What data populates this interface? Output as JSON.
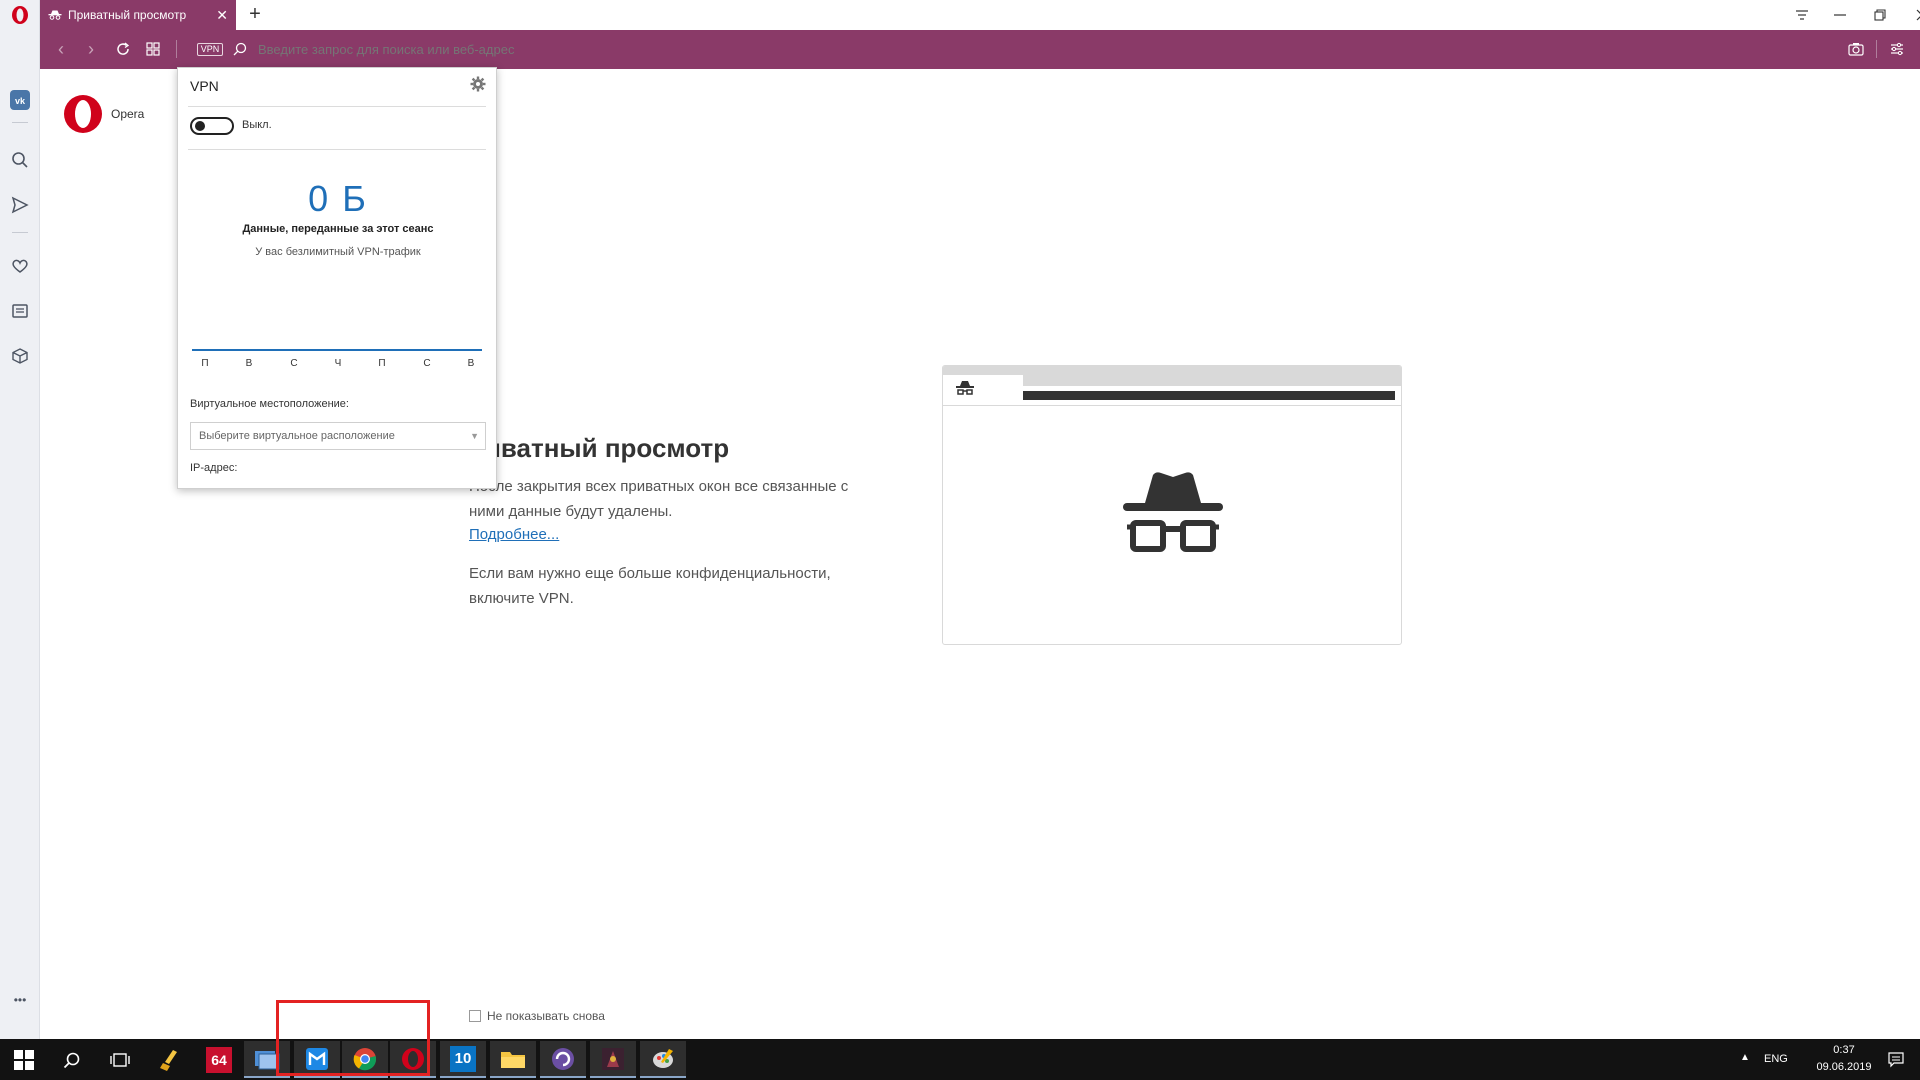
{
  "browser": {
    "tab_title": "Приватный просмотр",
    "address_placeholder": "Введите запрос для поиска или веб-адрес",
    "vpn_badge": "VPN"
  },
  "sidebar": {
    "items": [
      "vk-icon",
      "search-icon",
      "send-icon",
      "heart-icon",
      "news-icon",
      "box-icon"
    ],
    "more_label": "•••"
  },
  "speed_dial": {
    "logo_text": "Opera"
  },
  "private_page": {
    "title": "риватный просмотр",
    "text1": "После закрытия всех приватных окон все связанные с ними данные будут удалены.",
    "link": "Подробнее...",
    "text2": "Если вам нужно еще больше конфиденциальности, включите VPN.",
    "dont_show": "Не показывать снова"
  },
  "vpn_popup": {
    "title": "VPN",
    "toggle_label": "Выкл.",
    "data_amount": "0 Б",
    "data_caption": "Данные, переданные за этот сеанс",
    "unlimited": "У вас безлимитный VPN-трафик",
    "days": [
      "П",
      "В",
      "С",
      "Ч",
      "П",
      "С",
      "В"
    ],
    "location_label": "Виртуальное местоположение:",
    "location_placeholder": "Выберите виртуальное расположение",
    "ip_label": "IP-адрес:"
  },
  "taskbar": {
    "apps": [
      "start-icon",
      "search-icon",
      "task-view-icon",
      "ccleaner-icon",
      "aida64-icon",
      "explorer-window-icon",
      "maxthon-icon",
      "chrome-icon",
      "opera-icon",
      "app-10-icon",
      "file-explorer-icon",
      "torrent-icon",
      "game-icon",
      "paint-icon"
    ],
    "aida_label": "64",
    "ten_label": "10",
    "lang": "ENG",
    "time": "0:37",
    "date": "09.06.2019"
  },
  "colors": {
    "private_bar": "#8a3a68",
    "accent_blue": "#1f6fb8",
    "highlight": "#e32222"
  }
}
